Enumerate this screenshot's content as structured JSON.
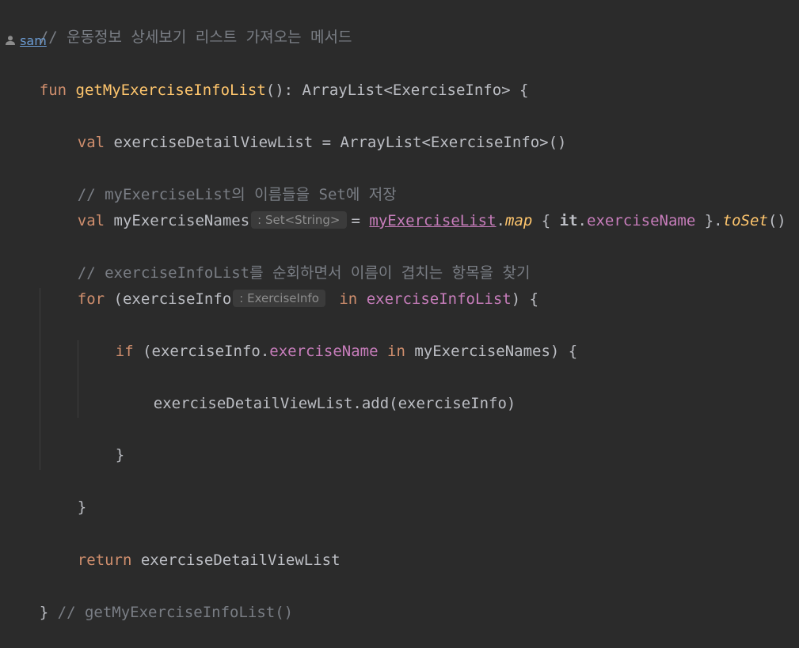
{
  "code": {
    "header_comment": "// 운동정보 상세보기 리스트 가져오는 메서드",
    "author": "sam",
    "line_fun": {
      "kw": "fun",
      "name": "getMyExerciseInfoList",
      "rest": "(): ArrayList<ExerciseInfo> {"
    },
    "line_val1": {
      "kw": "val",
      "rest": "exerciseDetailViewList = ArrayList<ExerciseInfo>()"
    },
    "comment2": "// myExerciseList의 이름들을 Set에 저장",
    "line_val2": {
      "kw": "val",
      "name": "myExerciseNames",
      "hint": ": Set<String>",
      "eq": "= ",
      "receiver": "myExerciseList",
      "dot": ".",
      "map": "map",
      "open": " { ",
      "it": "it",
      "dot2": ".",
      "prop": "exerciseName",
      "close": " }",
      "dot3": ".",
      "toset": "toSet",
      "parens": "()"
    },
    "comment3": "// exerciseInfoList를 순회하면서 이름이 겹치는 항목을 찾기",
    "line_for": {
      "kw": "for",
      "open": "(exerciseInfo",
      "hint": ": ExerciseInfo",
      "in": "in",
      "prop": "exerciseInfoList",
      "close": ") {"
    },
    "line_if": {
      "kw": "if",
      "open": "(exerciseInfo.",
      "prop": "exerciseName",
      "in": "in",
      "rest": "myExerciseNames) {"
    },
    "line_add": "exerciseDetailViewList.add(exerciseInfo)",
    "close_if": "}",
    "close_for": "}",
    "line_return": {
      "kw": "return",
      "rest": "exerciseDetailViewList"
    },
    "end_line": {
      "brace": "}",
      "comment": "// getMyExerciseInfoList()"
    }
  },
  "icons": {
    "author_icon": "person-icon"
  },
  "colors": {
    "background": "#2b2b2b",
    "keyword": "#cf8e6d",
    "function": "#ffc66d",
    "comment": "#7a7e85",
    "property": "#c77dbb",
    "text": "#bcbec4"
  }
}
